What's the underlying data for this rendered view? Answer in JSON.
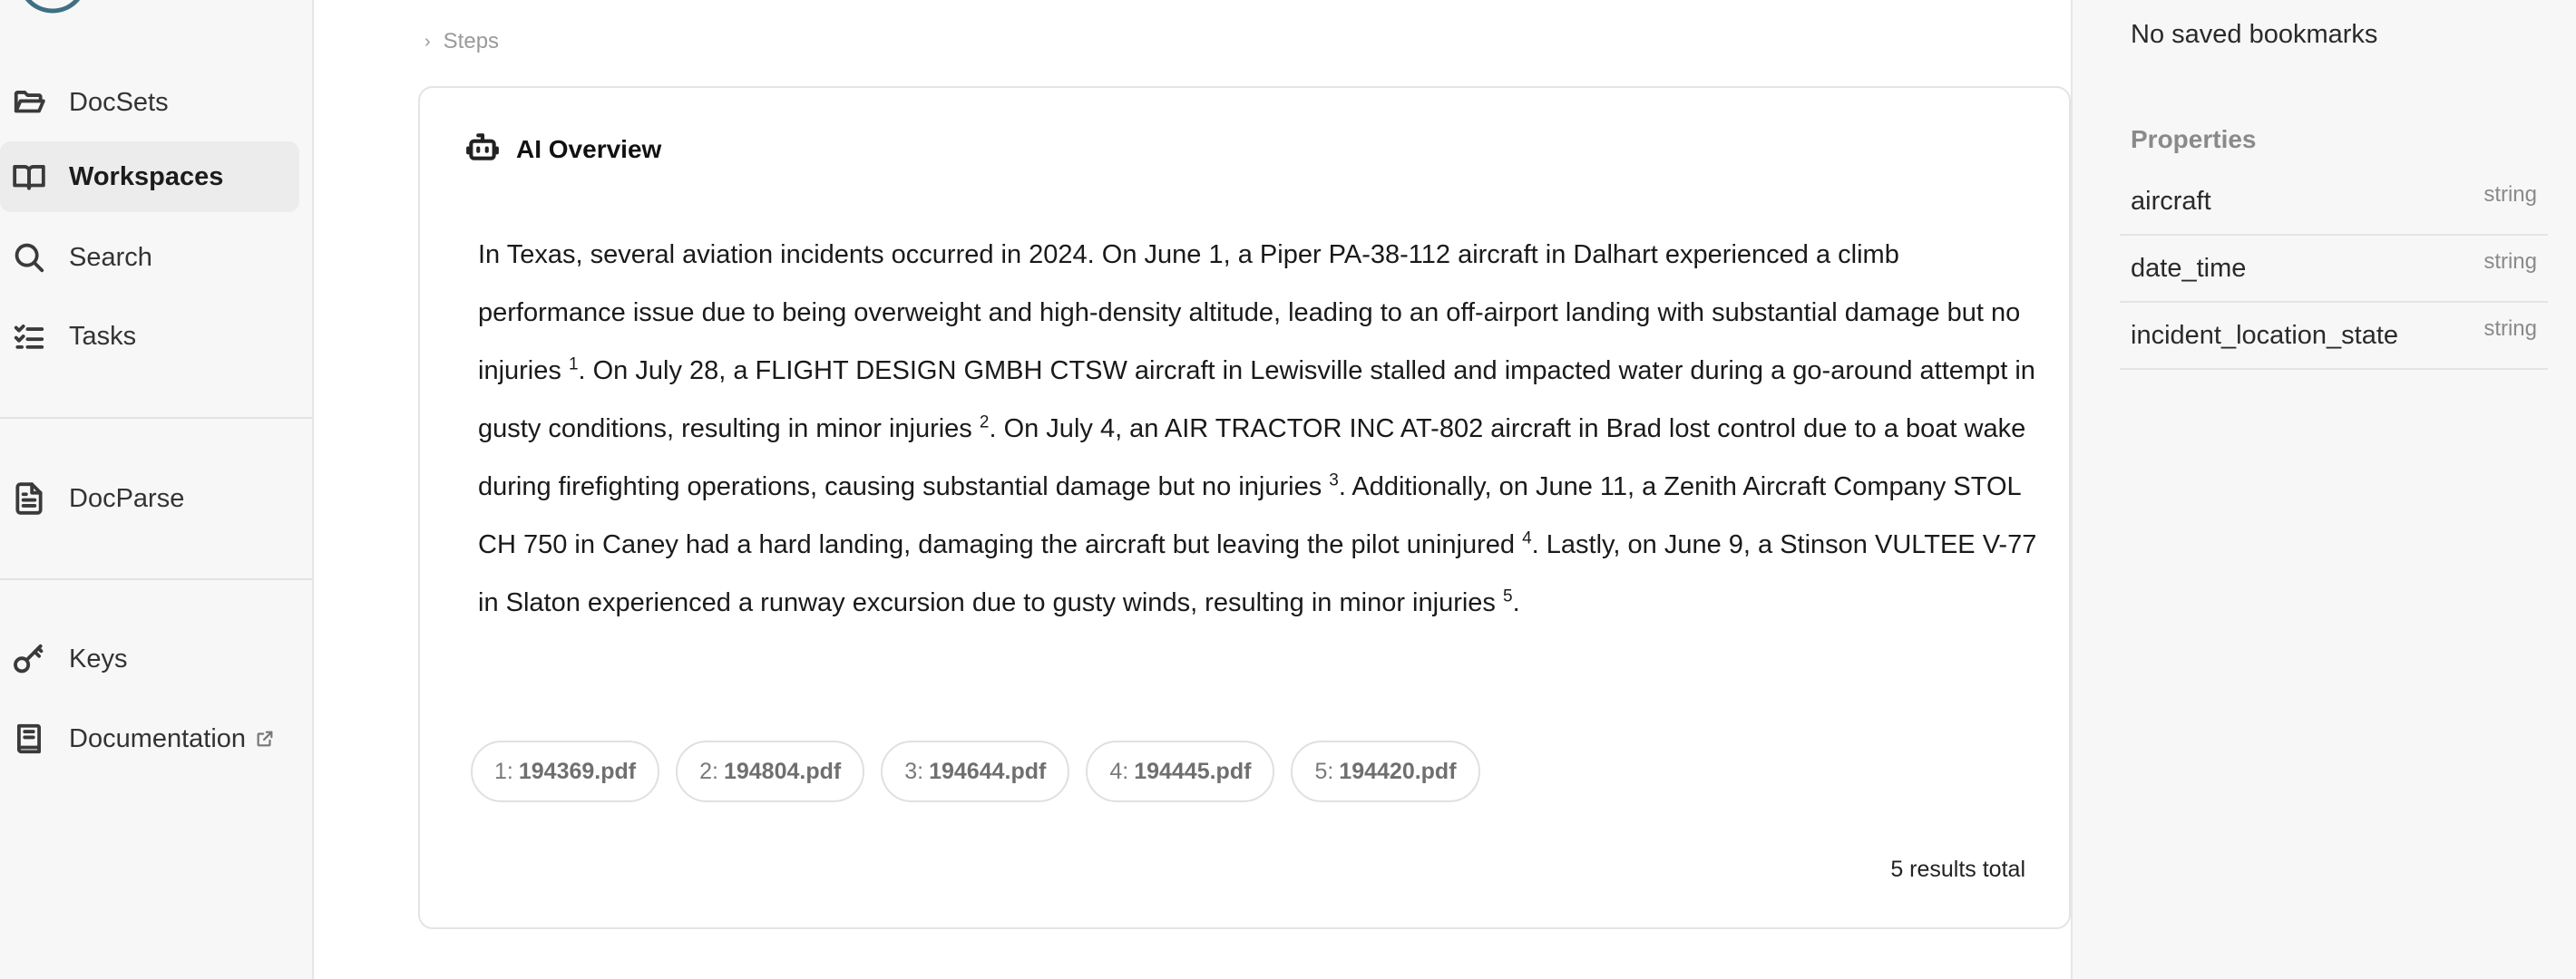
{
  "sidebar": {
    "items": [
      {
        "label": "DocSets",
        "icon": "folder-open-icon"
      },
      {
        "label": "Workspaces",
        "icon": "book-open-icon",
        "active": true
      },
      {
        "label": "Search",
        "icon": "search-icon"
      },
      {
        "label": "Tasks",
        "icon": "task-list-icon"
      },
      {
        "label": "DocParse",
        "icon": "document-icon"
      },
      {
        "label": "Keys",
        "icon": "key-icon"
      },
      {
        "label": "Documentation",
        "icon": "book-icon",
        "external_icon": "external-link-icon"
      }
    ]
  },
  "breadcrumb": {
    "label": "Steps"
  },
  "overview": {
    "title": "AI Overview",
    "icon": "robot-icon",
    "segments": [
      "In Texas, several aviation incidents occurred in 2024. On June 1, a Piper PA-38-112 aircraft in Dalhart experienced a climb performance issue due to being overweight and high-density altitude, leading to an off-airport landing with substantial damage but no injuries ",
      ". On July 28, a FLIGHT DESIGN GMBH CTSW aircraft in Lewisville stalled and impacted water during a go-around attempt in gusty conditions, resulting in minor injuries ",
      ". On July 4, an AIR TRACTOR INC AT-802 aircraft in Brad lost control due to a boat wake during firefighting operations, causing substantial damage but no injuries ",
      ". Additionally, on June 11, a Zenith Aircraft Company STOL CH 750 in Caney had a hard landing, damaging the aircraft but leaving the pilot uninjured ",
      ". Lastly, on June 9, a Stinson VULTEE V-77 in Slaton experienced a runway excursion due to gusty winds, resulting in minor injuries ",
      "."
    ],
    "citations": [
      "1",
      "2",
      "3",
      "4",
      "5"
    ],
    "sources": [
      {
        "num": "1:",
        "file": "194369.pdf"
      },
      {
        "num": "2:",
        "file": "194804.pdf"
      },
      {
        "num": "3:",
        "file": "194644.pdf"
      },
      {
        "num": "4:",
        "file": "194445.pdf"
      },
      {
        "num": "5:",
        "file": "194420.pdf"
      }
    ],
    "results_total": "5 results total"
  },
  "right_panel": {
    "bookmarks_empty": "No saved bookmarks",
    "properties_heading": "Properties",
    "properties": [
      {
        "name": "aircraft",
        "type": "string"
      },
      {
        "name": "date_time",
        "type": "string"
      },
      {
        "name": "incident_location_state",
        "type": "string"
      }
    ]
  },
  "colors": {
    "sidebar_bg": "#f7f7f7",
    "active_bg": "#ececec",
    "logo": "#3f6f83",
    "border": "#e4e4e4"
  }
}
